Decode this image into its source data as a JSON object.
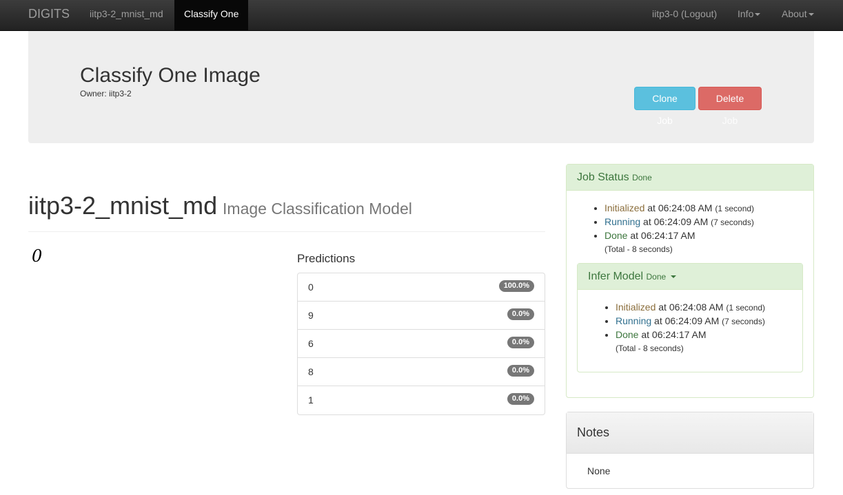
{
  "navbar": {
    "brand": "DIGITS",
    "model_link": "iitp3-2_mnist_md",
    "active": "Classify One",
    "user": "iitp3-0 (Logout)",
    "info": "Info",
    "about": "About"
  },
  "job": {
    "title": "Classify One Image",
    "owner": "Owner: iitp3-2",
    "clone_label": "Clone Job",
    "delete_label": "Delete Job"
  },
  "model": {
    "name": "iitp3-2_mnist_md",
    "subtitle": "Image Classification Model",
    "image_glyph": "0"
  },
  "predictions": {
    "title": "Predictions",
    "items": [
      {
        "label": "0",
        "value": "100.0%"
      },
      {
        "label": "9",
        "value": "0.0%"
      },
      {
        "label": "6",
        "value": "0.0%"
      },
      {
        "label": "8",
        "value": "0.0%"
      },
      {
        "label": "1",
        "value": "0.0%"
      }
    ]
  },
  "job_status": {
    "title": "Job Status",
    "state": "Done",
    "entries": [
      {
        "status": "Initialized",
        "at": " at 06:24:08 AM ",
        "duration": "(1 second)"
      },
      {
        "status": "Running",
        "at": " at 06:24:09 AM ",
        "duration": "(7 seconds)"
      },
      {
        "status": "Done",
        "at": " at 06:24:17 AM",
        "duration": ""
      }
    ],
    "total": "(Total - 8 seconds)"
  },
  "infer_model": {
    "title": "Infer Model",
    "state": "Done",
    "entries": [
      {
        "status": "Initialized",
        "at": " at 06:24:08 AM ",
        "duration": "(1 second)"
      },
      {
        "status": "Running",
        "at": " at 06:24:09 AM ",
        "duration": "(7 seconds)"
      },
      {
        "status": "Done",
        "at": " at 06:24:17 AM",
        "duration": ""
      }
    ],
    "total": "(Total - 8 seconds)"
  },
  "notes": {
    "title": "Notes",
    "body": "None"
  },
  "colors": {
    "navbar": "#222222",
    "info_button": "#5bc0de",
    "danger_button": "#d9534f",
    "success_panel": "#dff0d8"
  }
}
